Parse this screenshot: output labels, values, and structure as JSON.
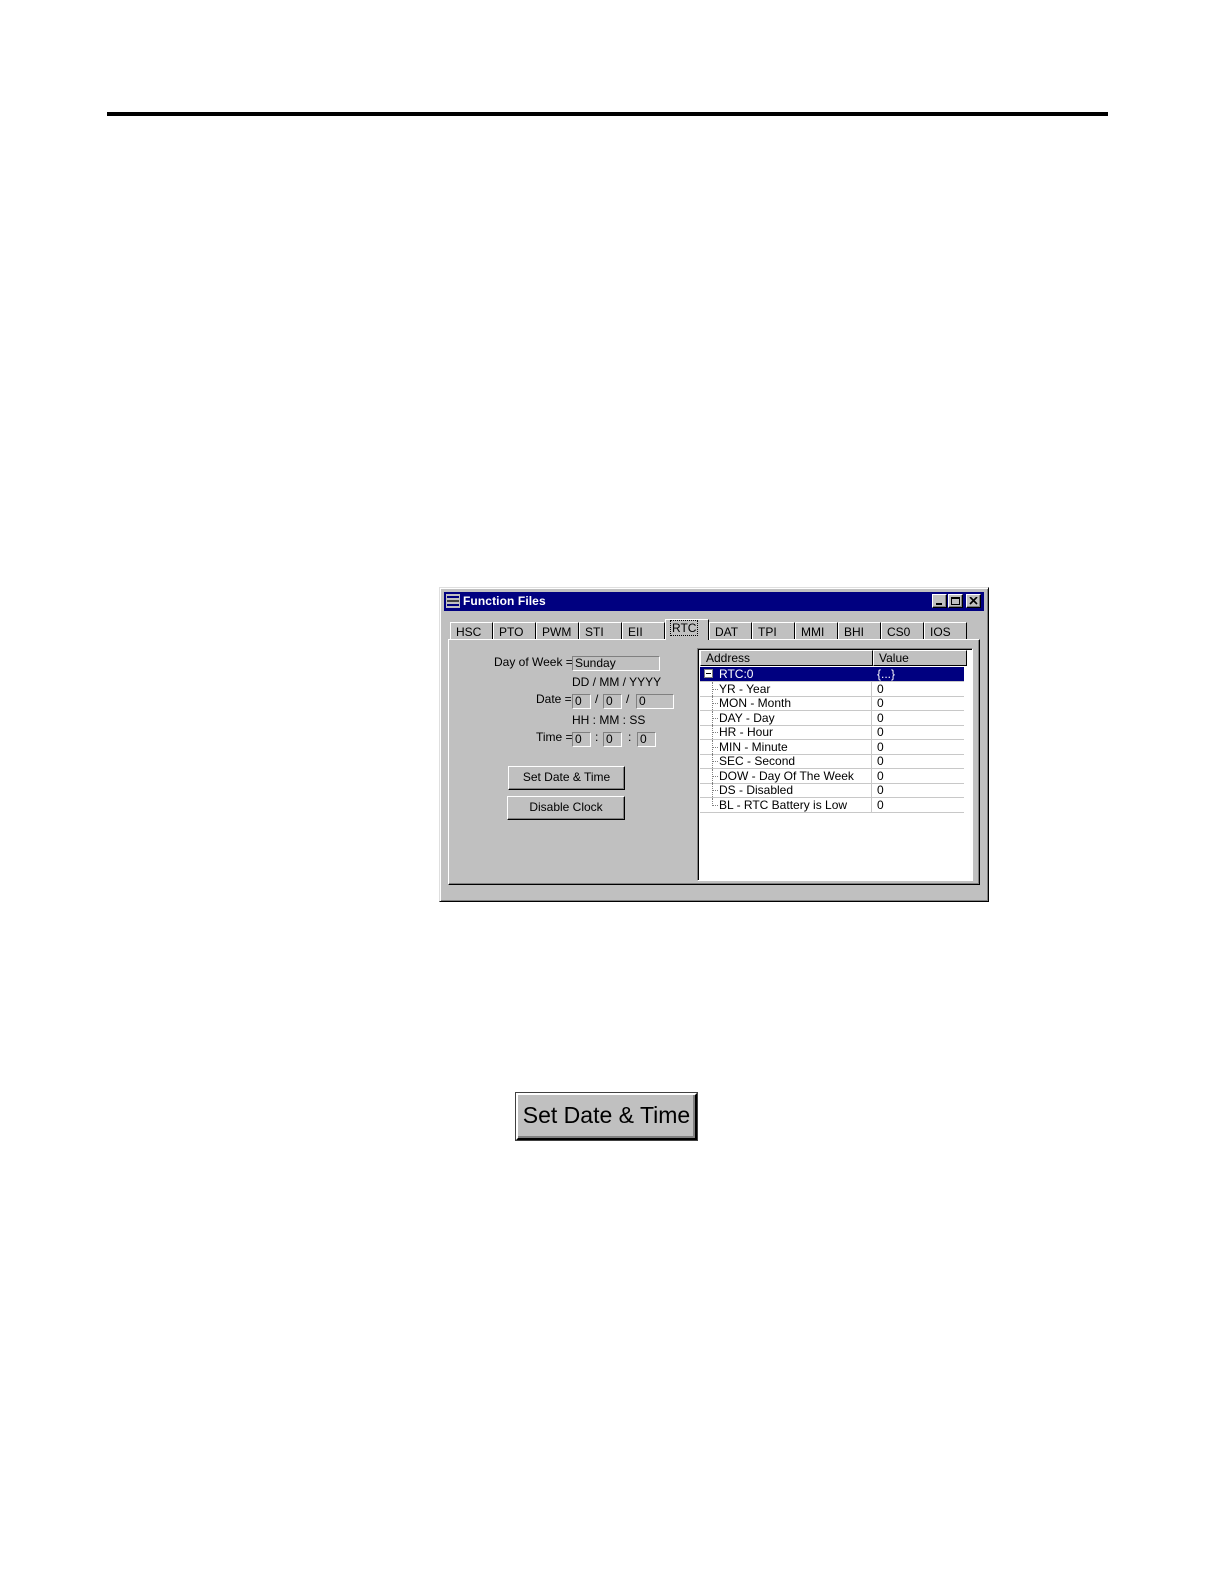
{
  "window": {
    "title": "Function Files",
    "tabs": [
      "HSC",
      "PTO",
      "PWM",
      "STI",
      "EII",
      "RTC",
      "DAT",
      "TPI",
      "MMI",
      "BHI",
      "CS0",
      "IOS"
    ],
    "active_tab": "RTC"
  },
  "form": {
    "day_of_week_label": "Day of Week =",
    "day_of_week_value": "Sunday",
    "date_header": "DD  /  MM  /  YYYY",
    "date_label": "Date =",
    "date_dd": "0",
    "date_mm": "0",
    "date_yyyy": "0",
    "slash": "/",
    "time_header": "HH  :  MM  :  SS",
    "time_label": "Time =",
    "time_hh": "0",
    "time_mm": "0",
    "time_ss": "0",
    "colon": ":",
    "set_button": "Set Date & Time",
    "disable_button": "Disable Clock"
  },
  "grid": {
    "headers": [
      "Address",
      "Value"
    ],
    "rows": [
      {
        "address": "RTC:0",
        "value": "{...}"
      },
      {
        "address": "YR - Year",
        "value": "0"
      },
      {
        "address": "MON - Month",
        "value": "0"
      },
      {
        "address": "DAY - Day",
        "value": "0"
      },
      {
        "address": "HR - Hour",
        "value": "0"
      },
      {
        "address": "MIN - Minute",
        "value": "0"
      },
      {
        "address": "SEC - Second",
        "value": "0"
      },
      {
        "address": "DOW - Day Of The Week",
        "value": "0"
      },
      {
        "address": "DS - Disabled",
        "value": "0"
      },
      {
        "address": "BL - RTC Battery is Low",
        "value": "0"
      }
    ]
  },
  "zoomed_button": "Set Date & Time",
  "colors": {
    "titlebar": "#000080",
    "face": "#c0c0c0",
    "selection": "#000080"
  }
}
